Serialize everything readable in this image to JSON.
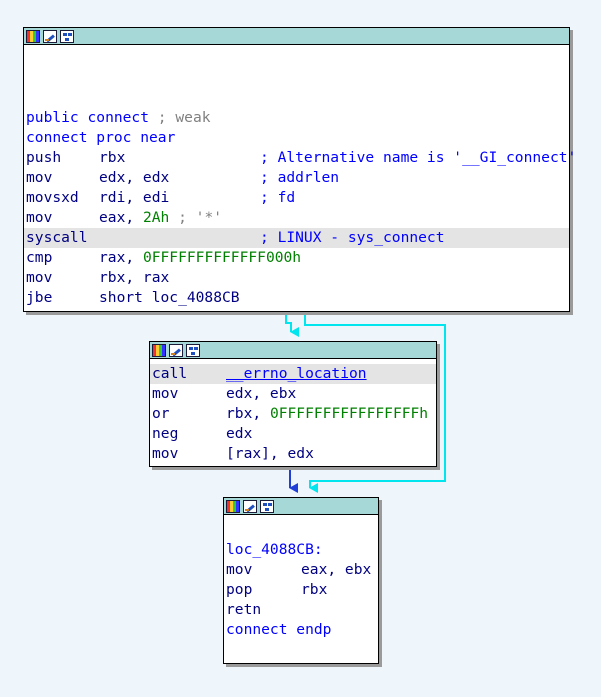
{
  "block1": {
    "lines": [
      {
        "a": "public connect",
        "b": " ; weak"
      },
      {
        "a": "connect proc near"
      },
      {
        "mn": "push",
        "op": "rbx",
        "cmt": "; Alternative name is '__GI_connect'"
      },
      {
        "mn": "mov",
        "op": "edx, edx",
        "cmt": "; addrlen"
      },
      {
        "mn": "movsxd",
        "op": "rdi, edi",
        "cmt": "; fd"
      },
      {
        "mn": "mov",
        "op1": "eax, ",
        "num": "2Ah",
        "tail": " ; '*'"
      },
      {
        "mn": "syscall",
        "cmt": "; LINUX - sys_connect"
      },
      {
        "mn": "cmp",
        "op1": "rax, ",
        "num": "0FFFFFFFFFFFFF000h"
      },
      {
        "mn": "mov",
        "op": "rbx, rax"
      },
      {
        "mn": "jbe",
        "op": "short loc_4088CB"
      }
    ]
  },
  "block2": {
    "lines": [
      {
        "mn": "call",
        "op": "__errno_location"
      },
      {
        "mn": "mov",
        "op": "edx, ebx"
      },
      {
        "mn": "or",
        "op1": "rbx, ",
        "num": "0FFFFFFFFFFFFFFFFh"
      },
      {
        "mn": "neg",
        "op": "edx"
      },
      {
        "mn": "mov",
        "op": "[rax], edx"
      }
    ]
  },
  "block3": {
    "lines": [
      {
        "a": "loc_4088CB:"
      },
      {
        "mn": "mov",
        "op": "eax, ebx"
      },
      {
        "mn": "pop",
        "op": "rbx"
      },
      {
        "mn": "retn"
      },
      {
        "a": "connect endp"
      }
    ]
  },
  "colors": {
    "titlebar": "#a7d8d8",
    "highlight": "#e4e4e4",
    "edge_false": "#00e5ee",
    "edge_flow": "#1f3fd6"
  },
  "icons": [
    "color-palette-icon",
    "edit-pencil-icon",
    "graph-view-icon"
  ]
}
